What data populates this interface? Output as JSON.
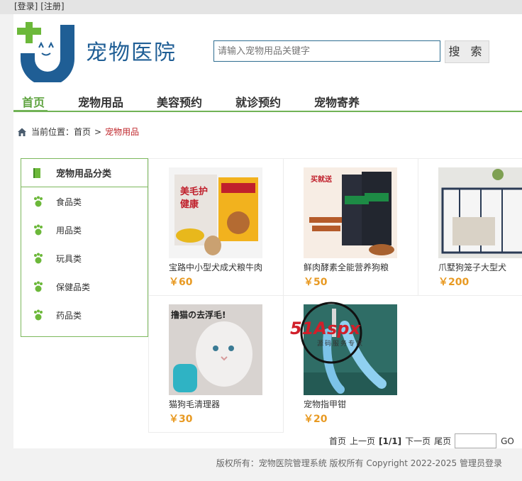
{
  "topbar": {
    "login": "[登录]",
    "register": "[注册]"
  },
  "logo": {
    "name": "宠物医院"
  },
  "search": {
    "placeholder": "请输入宠物用品关键字",
    "button": "搜 索"
  },
  "nav": [
    "首页",
    "宠物用品",
    "美容预约",
    "就诊预约",
    "宠物寄养"
  ],
  "breadcrumb": {
    "prefix": "当前位置：",
    "home": "首页",
    "sep": ">",
    "current": "宠物用品"
  },
  "sidebar": {
    "title": "宠物用品分类",
    "items": [
      "食品类",
      "用品类",
      "玩具类",
      "保健品类",
      "药品类"
    ]
  },
  "products": [
    {
      "name": "宝路中小型犬成犬粮牛肉",
      "price": "￥60",
      "img_text": "美毛护健康"
    },
    {
      "name": "鲜肉酵素全能营养狗粮",
      "price": "￥50",
      "img_text": "买就送"
    },
    {
      "name": "爪墅狗笼子大型犬",
      "price": "￥200",
      "img_text": ""
    },
    {
      "name": "猫狗毛清理器",
      "price": "￥30",
      "img_text": "撸猫の去浮毛!"
    },
    {
      "name": "宠物指甲钳",
      "price": "￥20",
      "img_text": ""
    }
  ],
  "pager": {
    "first": "首页",
    "prev": "上一页",
    "current": "[1/1]",
    "next": "下一页",
    "last": "尾页",
    "go": "GO"
  },
  "footer": "版权所有：宠物医院管理系统 版权所有 Copyright 2022-2025 管理员登录",
  "watermark": {
    "brand": "51Aspx",
    "sub": "源码服务专家"
  },
  "colors": {
    "accent_green": "#71b356",
    "price_orange": "#e89a23",
    "logo_blue": "#1f5e95",
    "crumb_red": "#c0282d"
  }
}
